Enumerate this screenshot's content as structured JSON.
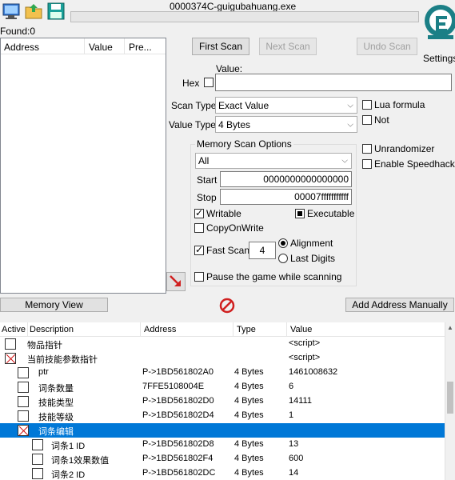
{
  "window": {
    "title": "0000374C-guigubahuang.exe",
    "found": "Found:0",
    "settings": "Settings"
  },
  "scan_list": {
    "columns": [
      "Address",
      "Value",
      "Pre..."
    ]
  },
  "buttons": {
    "first_scan": "First Scan",
    "next_scan": "Next Scan",
    "undo_scan": "Undo Scan",
    "memory_view": "Memory View",
    "add_address": "Add Address Manually"
  },
  "value_section": {
    "value_label": "Value:",
    "hex_label": "Hex",
    "scan_type_label": "Scan Type",
    "scan_type_value": "Exact Value",
    "value_type_label": "Value Type",
    "value_type_value": "4 Bytes",
    "lua_formula": "Lua formula",
    "not_label": "Not",
    "unrandomizer": "Unrandomizer",
    "enable_speedhack": "Enable Speedhack"
  },
  "memory_options": {
    "title": "Memory Scan Options",
    "region": "All",
    "start_label": "Start",
    "start_value": "0000000000000000",
    "stop_label": "Stop",
    "stop_value": "00007fffffffffff",
    "writable": "Writable",
    "executable": "Executable",
    "copy_on_write": "CopyOnWrite",
    "fast_scan": "Fast Scan",
    "fast_scan_value": "4",
    "alignment": "Alignment",
    "last_digits": "Last Digits",
    "pause_game": "Pause the game while scanning"
  },
  "address_table": {
    "columns": [
      "Active",
      "Description",
      "Address",
      "Type",
      "Value"
    ],
    "rows": [
      {
        "desc": "物品指针",
        "addr": "",
        "type": "",
        "value": "<script>"
      },
      {
        "desc": "当前技能参数指针",
        "addr": "",
        "type": "",
        "value": "<script>"
      },
      {
        "desc": "ptr",
        "addr": "P->1BD561802A0",
        "type": "4 Bytes",
        "value": "1461008632"
      },
      {
        "desc": "词条数量",
        "addr": "7FFE5108004E",
        "type": "4 Bytes",
        "value": "6"
      },
      {
        "desc": "技能类型",
        "addr": "P->1BD561802D0",
        "type": "4 Bytes",
        "value": "14111"
      },
      {
        "desc": "技能等级",
        "addr": "P->1BD561802D4",
        "type": "4 Bytes",
        "value": "1"
      },
      {
        "desc": "词条编辑",
        "addr": "",
        "type": "",
        "value": ""
      },
      {
        "desc": "词条1 ID",
        "addr": "P->1BD561802D8",
        "type": "4 Bytes",
        "value": "13"
      },
      {
        "desc": "词条1效果数值",
        "addr": "P->1BD561802F4",
        "type": "4 Bytes",
        "value": "600"
      },
      {
        "desc": "词条2 ID",
        "addr": "P->1BD561802DC",
        "type": "4 Bytes",
        "value": "14"
      }
    ]
  }
}
